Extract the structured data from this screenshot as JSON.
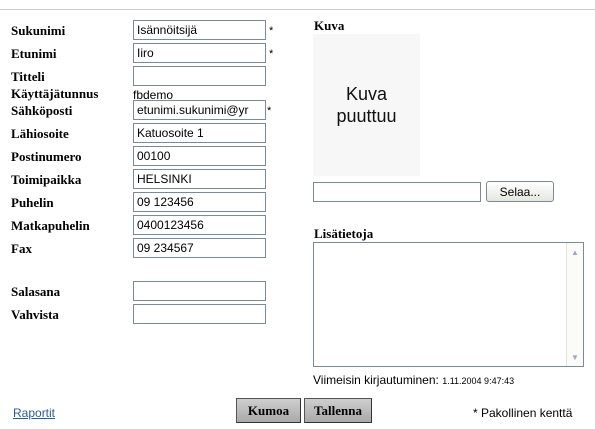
{
  "form": {
    "fields": {
      "sukunimi": {
        "label": "Sukunimi",
        "value": "Isännöitsijä",
        "required": "*"
      },
      "etunimi": {
        "label": "Etunimi",
        "value": "Iiro",
        "required": "*"
      },
      "titteli": {
        "label": "Titteli",
        "value": ""
      },
      "kayttajatunnus": {
        "label": "Käyttäjätunnus",
        "value": "fbdemo"
      },
      "sahkoposti": {
        "label": "Sähköposti",
        "value": "etunimi.sukunimi@yr",
        "required": "*"
      },
      "lahiosoite": {
        "label": "Lähiosoite",
        "value": "Katuosoite 1"
      },
      "postinumero": {
        "label": "Postinumero",
        "value": "00100"
      },
      "toimipaikka": {
        "label": "Toimipaikka",
        "value": "HELSINKI"
      },
      "puhelin": {
        "label": "Puhelin",
        "value": "09 123456"
      },
      "matkapuhelin": {
        "label": "Matkapuhelin",
        "value": "0400123456"
      },
      "fax": {
        "label": "Fax",
        "value": "09 234567"
      },
      "salasana": {
        "label": "Salasana",
        "value": ""
      },
      "vahvista": {
        "label": "Vahvista",
        "value": ""
      }
    }
  },
  "picture": {
    "title": "Kuva",
    "missing_line1": "Kuva",
    "missing_line2": "puuttuu",
    "browse_label": "Selaa..."
  },
  "notes": {
    "title": "Lisätietoja",
    "value": ""
  },
  "last_login": {
    "label": "Viimeisin kirjautuminen:",
    "timestamp": "1.11.2004 9:47:43"
  },
  "actions": {
    "cancel_label": "Kumoa",
    "save_label": "Tallenna"
  },
  "footer": {
    "reports_link": "Raportit",
    "required_note": "* Pakollinen kenttä"
  }
}
